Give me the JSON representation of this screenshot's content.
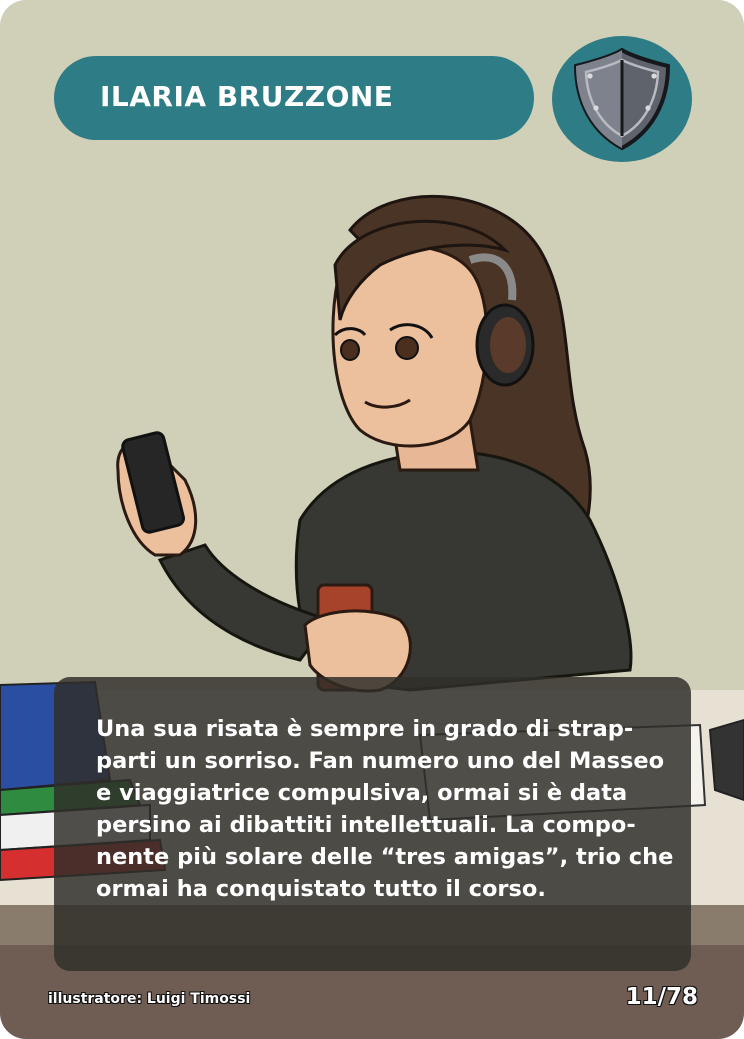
{
  "card": {
    "name": "ILARIA BRUZZONE",
    "emblem_icon": "shield-icon",
    "description": "Una sua risata è sempre in grado di strap-\nparti un sorriso. Fan numero uno del Masseo\ne viaggiatrice compulsiva, ormai si è data\npersino ai dibattiti intellettuali. La compo-\nnente più solare delle “tres amigas”, trio che\normai ha conquistato tutto il corso.",
    "illustrator_credit": "illustratore: Luigi Timossi",
    "card_number": "11/78"
  },
  "colors": {
    "background": "#d0cfb8",
    "accent": "#2e7c86",
    "text_box": "#302e2a"
  }
}
